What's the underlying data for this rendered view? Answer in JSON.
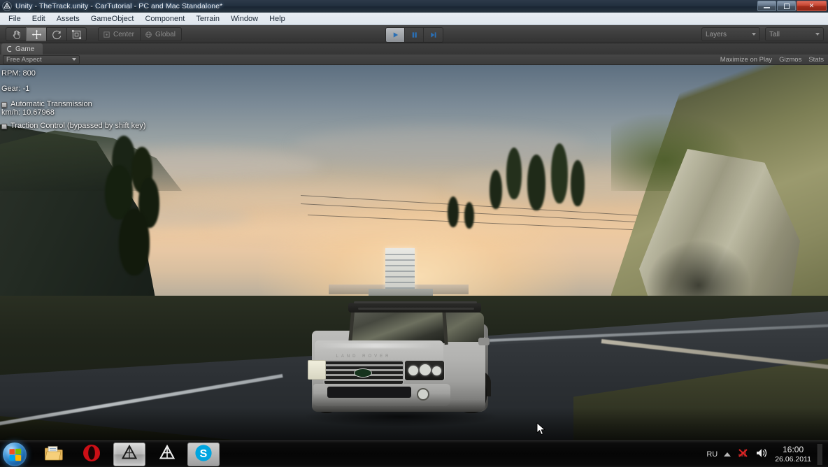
{
  "window": {
    "title": "Unity - TheTrack.unity - CarTutorial - PC and Mac Standalone*",
    "icon": "unity-icon",
    "controls": {
      "minimize": "minimize-button",
      "maximize": "maximize-button",
      "close": "close-button",
      "close_glyph": "✕"
    }
  },
  "menubar": {
    "items": [
      {
        "label": "File"
      },
      {
        "label": "Edit"
      },
      {
        "label": "Assets"
      },
      {
        "label": "GameObject"
      },
      {
        "label": "Component"
      },
      {
        "label": "Terrain"
      },
      {
        "label": "Window"
      },
      {
        "label": "Help"
      }
    ]
  },
  "toolbar": {
    "tools": [
      {
        "name": "hand-tool",
        "active": false
      },
      {
        "name": "move-tool",
        "active": true
      },
      {
        "name": "rotate-tool",
        "active": false
      },
      {
        "name": "scale-tool",
        "active": false
      }
    ],
    "pivot_mode": "Center",
    "pivot_rotation": "Global",
    "playback": [
      {
        "name": "play-button",
        "active": true
      },
      {
        "name": "pause-button",
        "active": false
      },
      {
        "name": "step-button",
        "active": false
      }
    ],
    "layers_label": "Layers",
    "layout_label": "Tall"
  },
  "gameview": {
    "tab_label": "Game",
    "tab_icon": "game-view-icon",
    "aspect": "Free Aspect",
    "maximize_on_play": "Maximize on Play",
    "gizmos": "Gizmos",
    "stats": "Stats"
  },
  "hud": {
    "rpm": "RPM: 800",
    "gear": "Gear: -1",
    "automatic_transmission": "Automatic Transmission",
    "speed": "km/h: 10.67968",
    "traction_control": "Traction Control (bypassed by shift key)"
  },
  "scene": {
    "description": "Third-person view of a silver Range Rover SUV driving on a mountain road at sunset, cliff faces on both sides and a distant city skyline.",
    "vehicle": "range-rover-suv",
    "badge_text": "LAND ROVER"
  },
  "taskbar": {
    "start": "start-button",
    "apps": [
      {
        "name": "file-explorer",
        "active": false
      },
      {
        "name": "opera-browser",
        "active": false
      },
      {
        "name": "unity-editor",
        "active": true
      },
      {
        "name": "unity-editor-2",
        "active": false
      },
      {
        "name": "skype",
        "active": false
      }
    ],
    "tray": {
      "language": "RU",
      "show_hidden": "show-hidden-icons",
      "volume": "volume-icon",
      "network": "network-icon",
      "time": "16:00",
      "date": "26.06.2011"
    }
  },
  "colors": {
    "accent": "#4a9ede",
    "unity_bg": "#3d3d3d",
    "title_bg": "#22303f",
    "menu_bg": "#e9eef3",
    "close_red": "#c3442f",
    "sky_warm": "#edc9a0"
  }
}
